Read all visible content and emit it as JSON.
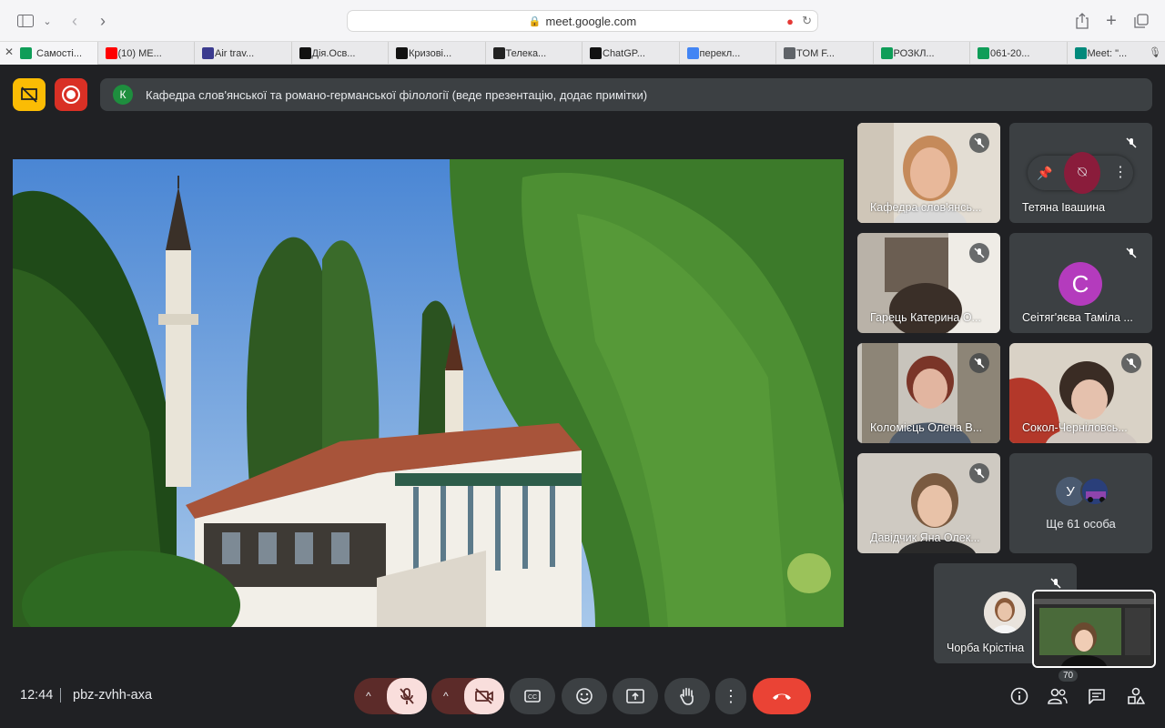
{
  "browser": {
    "url": "meet.google.com",
    "tabs": [
      {
        "label": "Самості...",
        "color": "#0f9d58"
      },
      {
        "label": "(10) ME...",
        "color": "#ff0000"
      },
      {
        "label": "Air trav...",
        "color": "#3b3b8f"
      },
      {
        "label": "Дія.Осв...",
        "color": "#111111"
      },
      {
        "label": "Кризові...",
        "color": "#111111"
      },
      {
        "label": "Телека...",
        "color": "#222222"
      },
      {
        "label": "ChatGP...",
        "color": "#111111"
      },
      {
        "label": "перекл...",
        "color": "#4285f4"
      },
      {
        "label": "TOM F...",
        "color": "#5f6368"
      },
      {
        "label": "РОЗКЛ...",
        "color": "#0f9d58"
      },
      {
        "label": "061-20...",
        "color": "#0f9d58"
      },
      {
        "label": "Meet: \"...",
        "color": "#00897b"
      }
    ]
  },
  "meet": {
    "banner_initial": "К",
    "banner_text": "Кафедра слов'янської та романо-германської філології (веде презентацію, додає примітки)",
    "participants": [
      {
        "name": "Кафедра слов'янсь...",
        "type": "video"
      },
      {
        "name": "Тетяна Івашина",
        "type": "hover"
      },
      {
        "name": "Гарець Катерина О...",
        "type": "video"
      },
      {
        "name": "Сеітяг'яєва Таміла ...",
        "type": "avatar",
        "initial": "С",
        "avatar_color": "#b43bbd"
      },
      {
        "name": "Коломієць Олена В...",
        "type": "video"
      },
      {
        "name": "Сокол-Чернiловсь...",
        "type": "video"
      },
      {
        "name": "Давідчик Яна Олек...",
        "type": "video"
      },
      {
        "name": "Ще 61 особа",
        "type": "more",
        "initial": "У"
      },
      {
        "name": "Чорба Крістіна",
        "type": "small-avatar"
      }
    ],
    "meeting_time": "12:44",
    "meeting_code": "pbz-zvhh-axa",
    "participant_count": "70",
    "colors": {
      "end_call": "#ea4335",
      "muted_red": "#f9dedc",
      "dark_red": "#5c2b29",
      "banner_yellow": "#fbbc04",
      "record_red": "#d93025"
    }
  }
}
